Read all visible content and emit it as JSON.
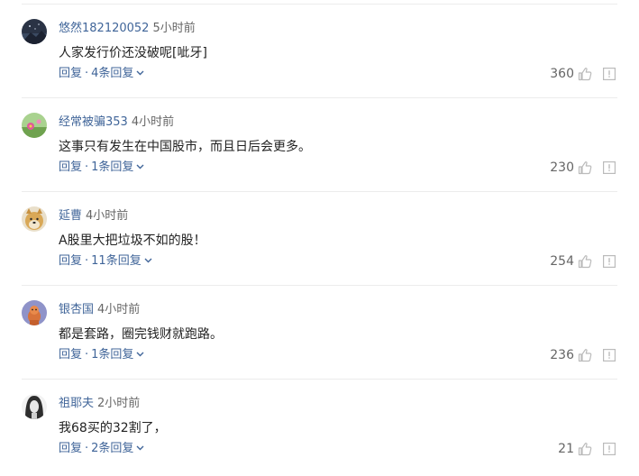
{
  "comments": [
    {
      "user": "悠然182120052",
      "time": "5小时前",
      "text": "人家发行价还没破呢[呲牙]",
      "reply_label": "回复",
      "sep": "·",
      "replies_label": "4条回复",
      "likes": "360",
      "avatar_icon": "night-sky-avatar"
    },
    {
      "user": "经常被骗353",
      "time": "4小时前",
      "text": "这事只有发生在中国股市，而且日后会更多。",
      "reply_label": "回复",
      "sep": "·",
      "replies_label": "1条回复",
      "likes": "230",
      "avatar_icon": "flower-avatar"
    },
    {
      "user": "延曹",
      "time": "4小时前",
      "text": "A股里大把垃圾不如的股！",
      "reply_label": "回复",
      "sep": "·",
      "replies_label": "11条回复",
      "likes": "254",
      "avatar_icon": "doge-avatar"
    },
    {
      "user": "银杏国",
      "time": "4小时前",
      "text": "都是套路，圈完钱财就跑路。",
      "reply_label": "回复",
      "sep": "·",
      "replies_label": "1条回复",
      "likes": "236",
      "avatar_icon": "cartoon-avatar"
    },
    {
      "user": "祖耶夫",
      "time": "2小时前",
      "text": "我68买的32割了，",
      "reply_label": "回复",
      "sep": "·",
      "replies_label": "2条回复",
      "likes": "21",
      "avatar_icon": "portrait-avatar"
    }
  ],
  "colors": {
    "link": "#406599",
    "muted": "#666666",
    "text": "#222222",
    "divider": "#ececec",
    "icon": "#bbbbbb"
  }
}
